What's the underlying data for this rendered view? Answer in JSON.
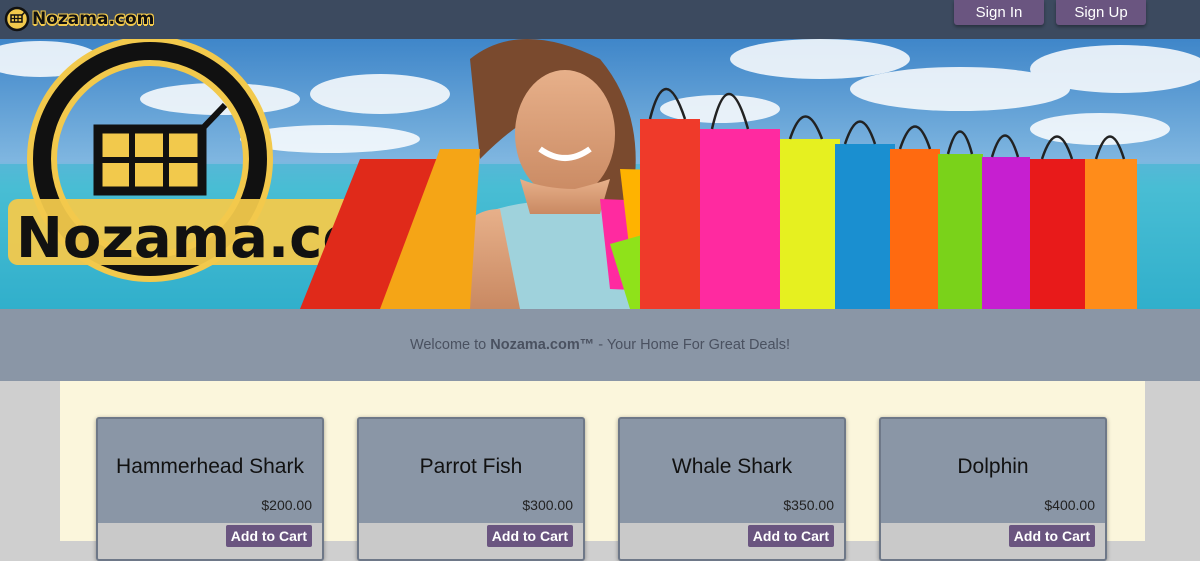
{
  "navbar": {
    "brand": "Nozama.com",
    "signin_label": "Sign In",
    "signup_label": "Sign Up"
  },
  "hero": {
    "logo_text": "Nozama.com"
  },
  "welcome": {
    "prefix": "Welcome to ",
    "brand": "Nozama.com™",
    "suffix": " - Your Home For Great Deals!"
  },
  "products": [
    {
      "name": "Hammerhead Shark",
      "price": "$200.00",
      "button": "Add to Cart"
    },
    {
      "name": "Parrot Fish",
      "price": "$300.00",
      "button": "Add to Cart"
    },
    {
      "name": "Whale Shark",
      "price": "$350.00",
      "button": "Add to Cart"
    },
    {
      "name": "Dolphin",
      "price": "$400.00",
      "button": "Add to Cart"
    }
  ],
  "colors": {
    "navbar": "#3c4a5f",
    "button": "#6a5580",
    "welcome_band": "#8a96a6",
    "products_bg": "#fbf6dc",
    "logo_yellow": "#f2c94c"
  }
}
